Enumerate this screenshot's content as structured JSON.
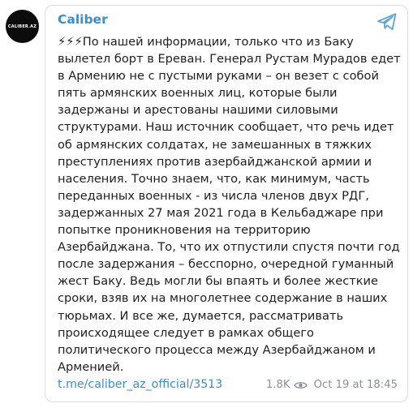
{
  "channel": {
    "name": "Caliber",
    "avatar_text": "CALIBER.AZ"
  },
  "message": {
    "text": "⚡⚡⚡По нашей информации, только что из Баку\nвылетел борт в Ереван. Генерал Рустам Мурадов едет\nв Армению не с пустыми руками – он везет с собой\nпять армянских военных лиц, которые были\nзадержаны и арестованы нашими силовыми\nструктурами. Наш источник сообщает, что речь идет\nоб армянских солдатах, не замешанных в тяжких\nпреступлениях против азербайджанской армии и\nнаселения. Точно знаем, что, как минимум, часть\nпереданных военных - из числа членов двух РДГ,\nзадержанных 27 мая 2021 года в Кельбаджаре при\nпопытке проникновения на территорию\nАзербайджана. То, что их отпустили спустя почти год\nпосле задержания – бесспорно, очередной гуманный\nжест Баку. Ведь могли бы впаять и более жесткие\nсроки, взяв их на многолетнее содержание в наших\nтюрьмах. И все же, думается, рассматривать\nпроисходящее следует в рамках общего\nполитического процесса между Азербайджаном и\nАрменией."
  },
  "footer": {
    "link": "t.me/caliber_az_official/3513",
    "views": "1.8K",
    "timestamp": "Oct 19 at 18:45"
  },
  "icons": {
    "share": "share-arrow-icon",
    "views": "eye-icon"
  },
  "colors": {
    "accent": "#3a8ed0",
    "text": "#1f1f1f",
    "muted": "#8a9096",
    "border": "#d9dde1",
    "avatar_bg": "#0c0c0c"
  }
}
